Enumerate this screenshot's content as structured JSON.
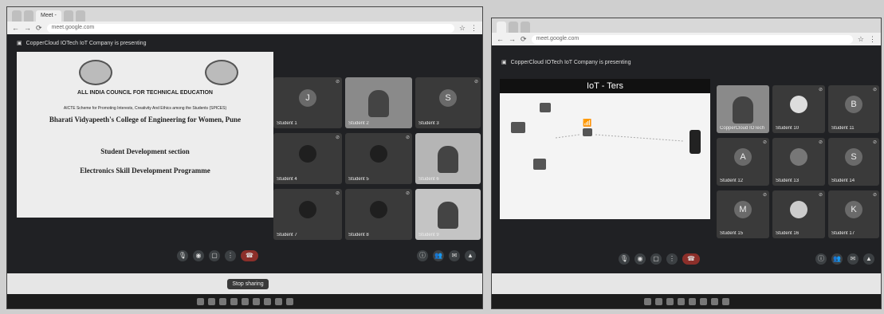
{
  "left_screen": {
    "tabs": [
      "",
      "",
      "Meet - ",
      "",
      ""
    ],
    "address": "meet.google.com",
    "presenting_text": "CopperCloud IOTech IoT Company is presenting",
    "slide": {
      "header": "ALL INDIA COUNCIL FOR TECHNICAL EDUCATION",
      "scheme": "AICTE Scheme for Promoting Interests, Creativity And Ethics among the Students (SPICES)",
      "college": "Bharati Vidyapeeth's College of Engineering for Women, Pune",
      "address_line": "",
      "section": "Student Development section",
      "program": "Electronics Skill Development Programme"
    },
    "participants": [
      {
        "initial": "J",
        "name": "Student 1"
      },
      {
        "initial": "",
        "name": "Student 2"
      },
      {
        "initial": "S",
        "name": "Student 3"
      },
      {
        "initial": "",
        "name": "Student 4"
      },
      {
        "initial": "",
        "name": "Student 5"
      },
      {
        "initial": "",
        "name": "Student 6"
      },
      {
        "initial": "",
        "name": "Student 7"
      },
      {
        "initial": "",
        "name": "Student 8"
      },
      {
        "initial": "",
        "name": "Student 9"
      }
    ],
    "controls_left": "",
    "meeting_code": "",
    "sharebar_text": "",
    "stop_sharing": "Stop sharing"
  },
  "right_screen": {
    "tabs": [
      "",
      "",
      ""
    ],
    "address": "meet.google.com",
    "presenting_text": "CopperCloud IOTech IoT Company is presenting",
    "slide": {
      "title": "IoT - Ters",
      "labels": [
        "",
        "",
        "",
        ""
      ]
    },
    "participants": [
      {
        "initial": "",
        "name": "CopperCloud IOTech"
      },
      {
        "initial": "",
        "name": "Student 10"
      },
      {
        "initial": "B",
        "name": "Student 11"
      },
      {
        "initial": "A",
        "name": "Student 12"
      },
      {
        "initial": "",
        "name": "Student 13"
      },
      {
        "initial": "S",
        "name": "Student 14"
      },
      {
        "initial": "M",
        "name": "Student 15"
      },
      {
        "initial": "",
        "name": "Student 16"
      },
      {
        "initial": "K",
        "name": "Student 17"
      }
    ],
    "controls_left": "",
    "meeting_code": "",
    "sharebar_text": ""
  }
}
